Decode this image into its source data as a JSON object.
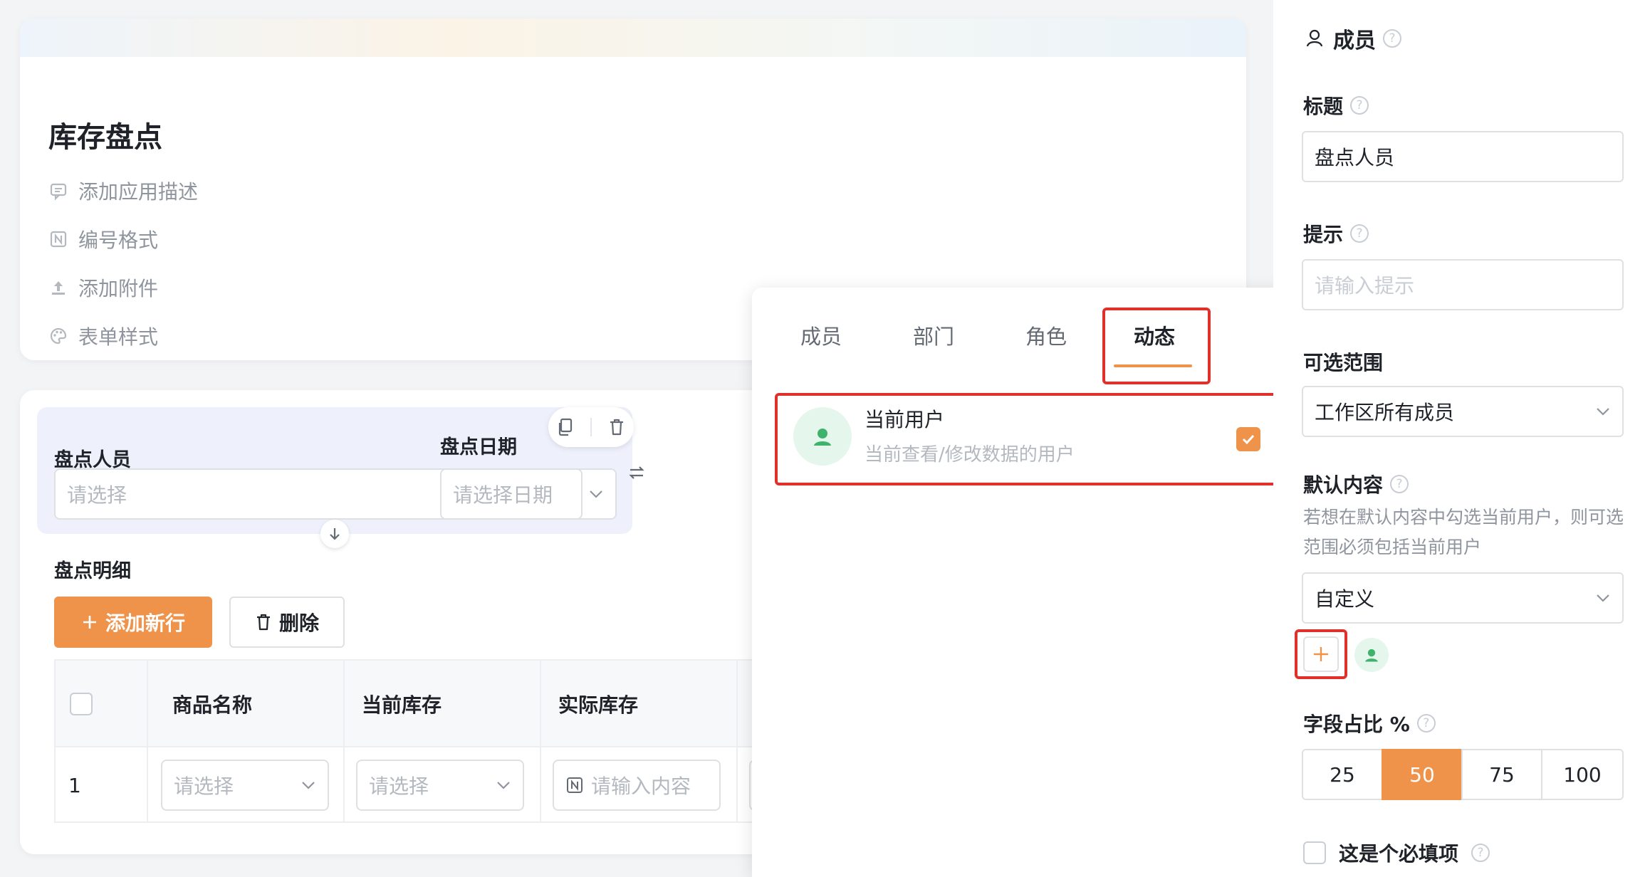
{
  "header": {
    "app_title": "库存盘点",
    "meta_items": [
      {
        "label": "添加应用描述",
        "icon": "comment-icon"
      },
      {
        "label": "编号格式",
        "icon": "numbering-icon"
      },
      {
        "label": "添加附件",
        "icon": "upload-icon"
      },
      {
        "label": "表单样式",
        "icon": "palette-icon"
      }
    ]
  },
  "form": {
    "field1": {
      "label": "盘点人员",
      "placeholder": "请选择"
    },
    "field2": {
      "label": "盘点日期",
      "placeholder": "请选择日期"
    },
    "subtable": {
      "label": "盘点明细",
      "add_button": "添加新行",
      "delete_button": "删除",
      "columns": [
        "商品名称",
        "当前库存",
        "实际库存"
      ],
      "rows": [
        {
          "index": "1",
          "name_placeholder": "请选择",
          "current_placeholder": "请选择",
          "actual_placeholder": "请输入内容"
        }
      ]
    }
  },
  "dropdown": {
    "tabs": [
      "成员",
      "部门",
      "角色",
      "动态"
    ],
    "active_tab": "动态",
    "option": {
      "title": "当前用户",
      "description": "当前查看/修改数据的用户",
      "checked": true
    }
  },
  "panel": {
    "title": "成员",
    "title_label": "标题",
    "title_value": "盘点人员",
    "hint_label": "提示",
    "hint_placeholder": "请输入提示",
    "range_label": "可选范围",
    "range_value": "工作区所有成员",
    "default_label": "默认内容",
    "default_note": "若想在默认内容中勾选当前用户，则可选范围必须包括当前用户",
    "default_value": "自定义",
    "width_label": "字段占比 %",
    "width_options": [
      "25",
      "50",
      "75",
      "100"
    ],
    "width_selected": "50",
    "required_label": "这是个必填项",
    "required_checked": false
  },
  "colors": {
    "accent": "#f0934a",
    "highlight_border": "#e0302a",
    "avatar_green": "#3fb36b",
    "selected_field_bg": "#eef1fb"
  }
}
